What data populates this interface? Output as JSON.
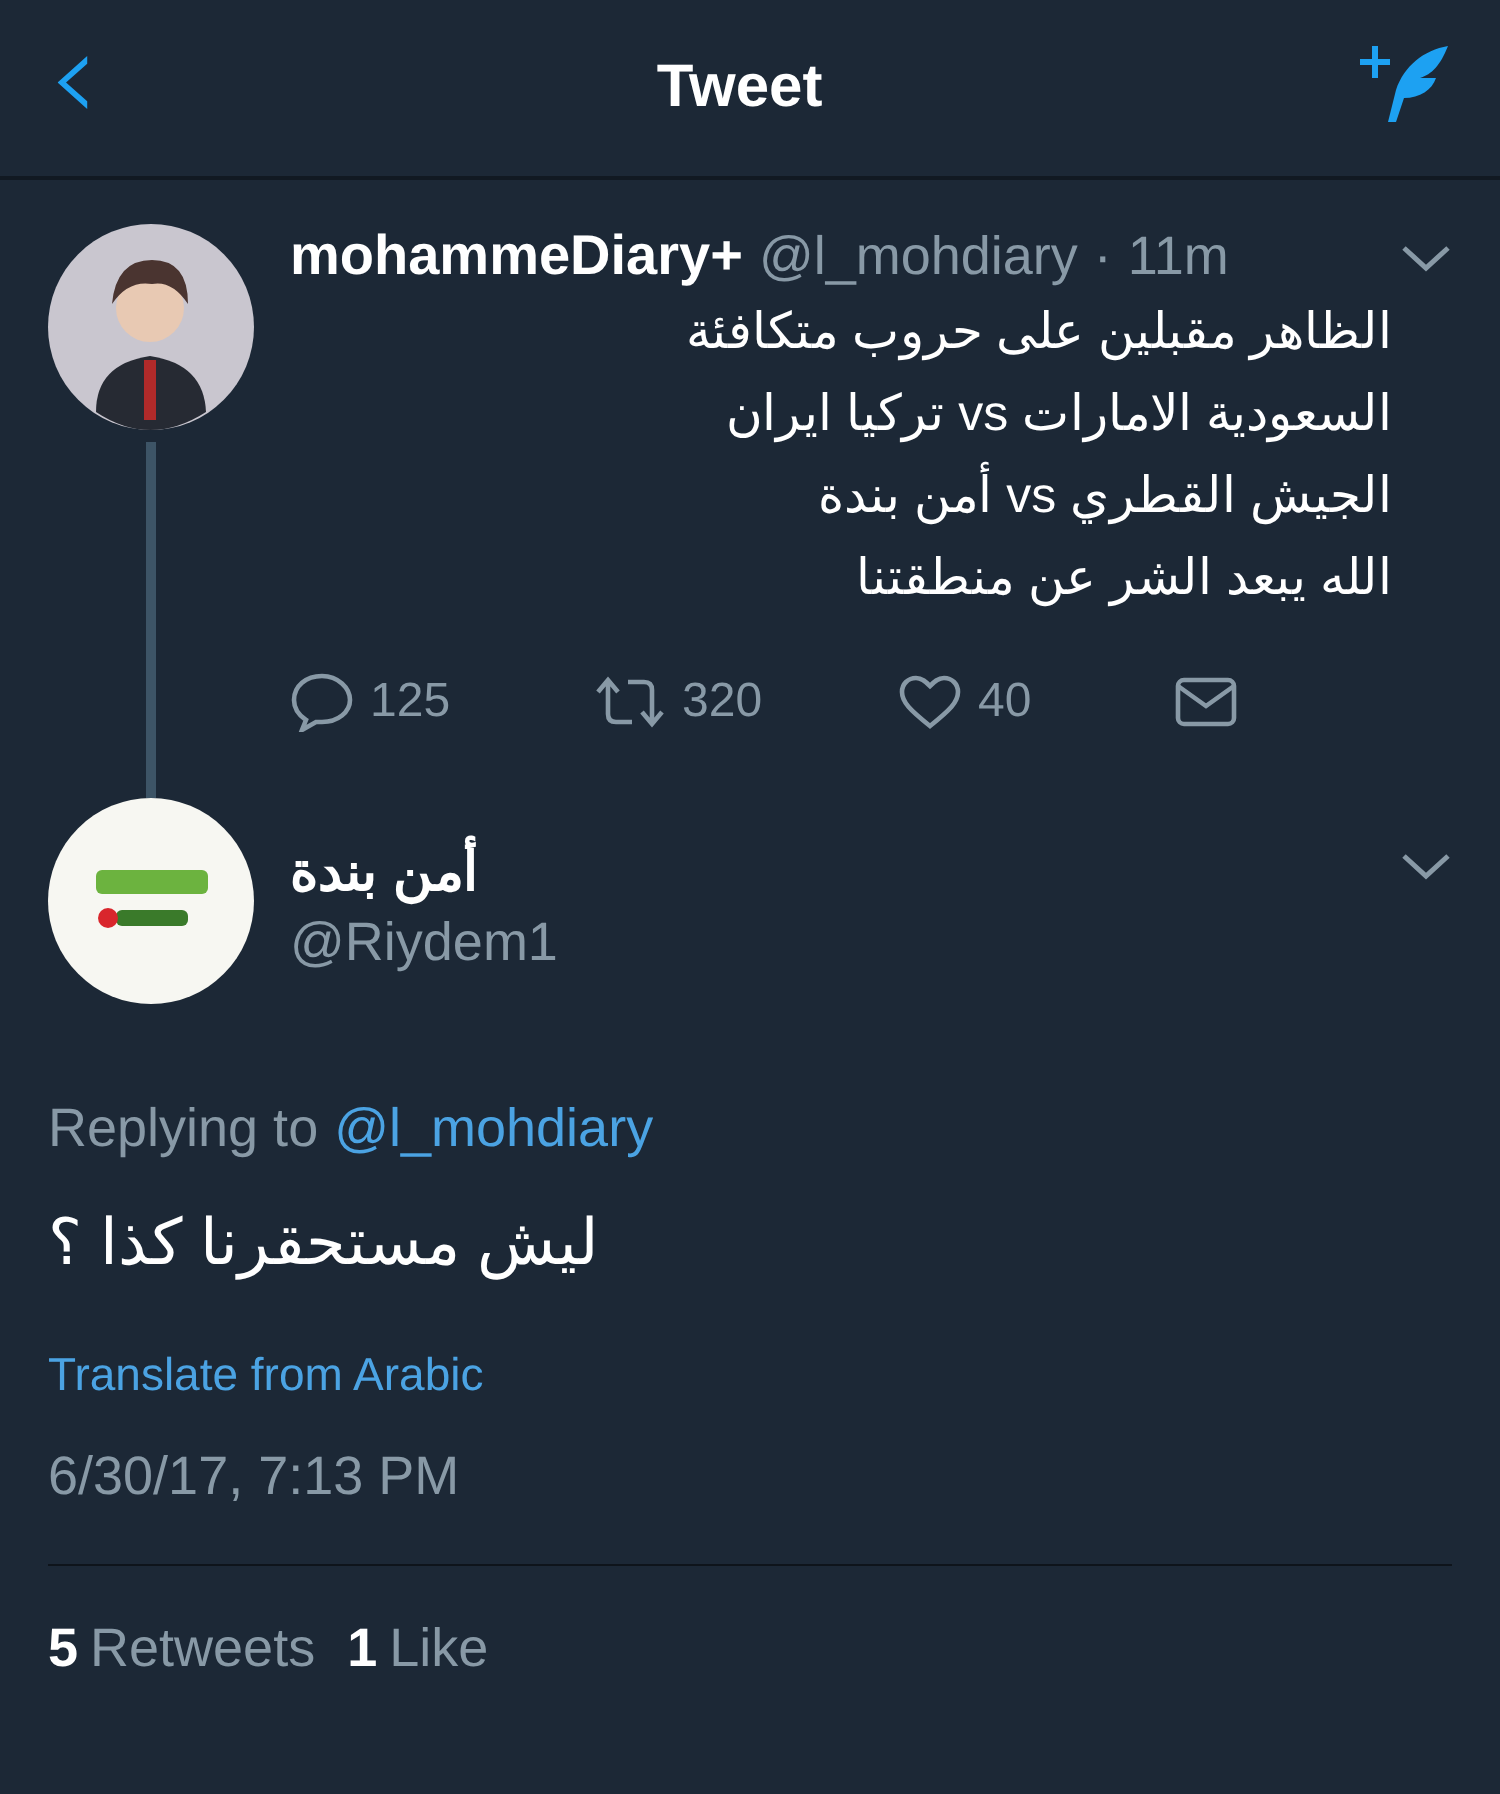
{
  "header": {
    "back": "‹",
    "title": "Tweet"
  },
  "parent_tweet": {
    "name": "mohammeDiary+",
    "handle": "@l_mohdiary",
    "separator": "·",
    "time": "11m",
    "text": "الظاهر مقبلين على حروب متكافئة\nالسعودية الامارات vs تركيا ايران\nالجيش القطري vs أمن بندة\nالله يبعد الشر عن منطقتنا",
    "actions": {
      "reply": {
        "count": "125"
      },
      "retweet": {
        "count": "320"
      },
      "like": {
        "count": "40"
      }
    }
  },
  "reply_tweet": {
    "name": "أمن بندة",
    "handle": "@Riydem1",
    "replying_prefix": "Replying to",
    "replying_handle": "@l_mohdiary",
    "text": "ليش مستحقرنا كذا ؟",
    "translate": "Translate from Arabic",
    "timestamp": "6/30/17, 7:13 PM",
    "stats": {
      "retweets": {
        "count": "5",
        "label": "Retweets"
      },
      "likes": {
        "count": "1",
        "label": "Like"
      }
    }
  }
}
